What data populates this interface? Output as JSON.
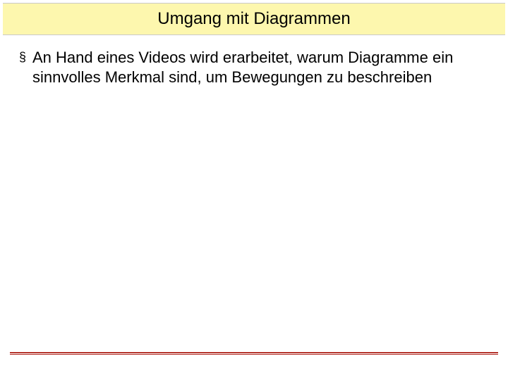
{
  "title": "Umgang mit Diagrammen",
  "bullets": [
    "An Hand eines Videos wird erarbeitet, warum Diagramme ein sinnvolles Merkmal sind, um Bewegungen zu beschreiben"
  ],
  "bullet_glyph": "§"
}
